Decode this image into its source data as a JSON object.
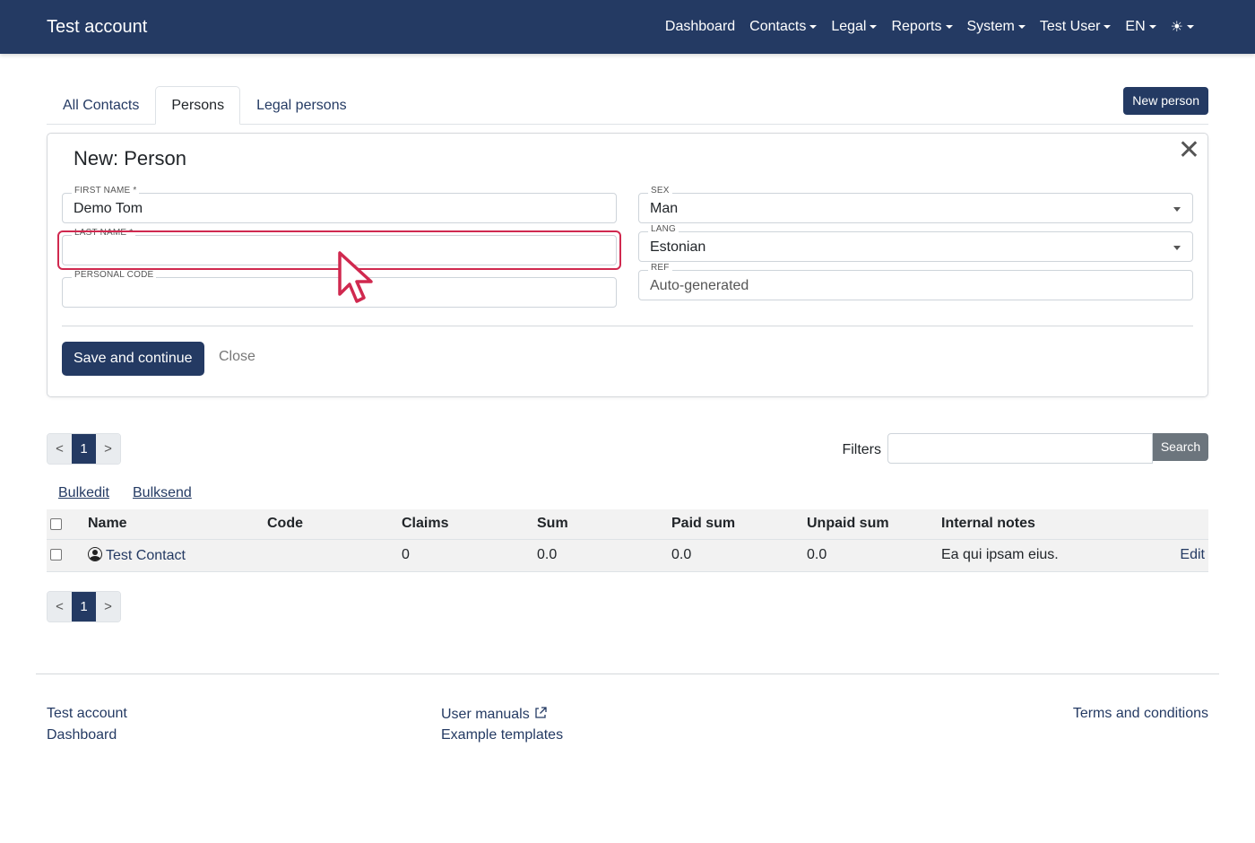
{
  "navbar": {
    "brand": "Test account",
    "items": [
      {
        "label": "Dashboard",
        "dropdown": false
      },
      {
        "label": "Contacts",
        "dropdown": true
      },
      {
        "label": "Legal",
        "dropdown": true
      },
      {
        "label": "Reports",
        "dropdown": true
      },
      {
        "label": "System",
        "dropdown": true
      },
      {
        "label": "Test User",
        "dropdown": true
      },
      {
        "label": "EN",
        "dropdown": true
      }
    ],
    "theme_icon": "☀"
  },
  "tabs": [
    {
      "label": "All Contacts",
      "active": false
    },
    {
      "label": "Persons",
      "active": true
    },
    {
      "label": "Legal persons",
      "active": false
    }
  ],
  "new_button": "New person",
  "form": {
    "title": "New: Person",
    "fields": {
      "first_name": {
        "label": "FIRST NAME *",
        "value": "Demo Tom"
      },
      "last_name": {
        "label": "LAST NAME *",
        "value": ""
      },
      "personal_code": {
        "label": "PERSONAL CODE",
        "value": ""
      },
      "sex": {
        "label": "SEX",
        "value": "Man"
      },
      "lang": {
        "label": "LANG",
        "value": "Estonian"
      },
      "ref": {
        "label": "REF",
        "placeholder": "Auto-generated"
      }
    },
    "save_label": "Save and continue",
    "close_label": "Close",
    "close_icon": "✕"
  },
  "pager": {
    "prev": "<",
    "current": "1",
    "next": ">"
  },
  "filters": {
    "label": "Filters",
    "search_label": "Search",
    "value": ""
  },
  "bulk": {
    "edit": "Bulkedit",
    "send": "Bulksend"
  },
  "table": {
    "headers": [
      "Name",
      "Code",
      "Claims",
      "Sum",
      "Paid sum",
      "Unpaid sum",
      "Internal notes"
    ],
    "rows": [
      {
        "name": "Test Contact",
        "code": "",
        "claims": "0",
        "sum": "0.0",
        "paid_sum": "0.0",
        "unpaid_sum": "0.0",
        "notes": "Ea qui ipsam eius.",
        "action": "Edit"
      }
    ]
  },
  "footer": {
    "col1": [
      "Test account",
      "Dashboard"
    ],
    "col2": [
      "User manuals",
      "Example templates"
    ],
    "col3": [
      "Terms and conditions"
    ]
  },
  "colors": {
    "primary": "#243a63",
    "highlight": "#d0294f",
    "secondary": "#6c757d"
  }
}
